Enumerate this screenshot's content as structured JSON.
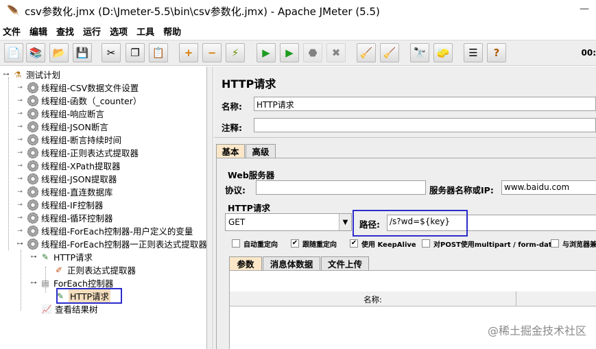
{
  "window": {
    "title": "csv参数化.jmx (D:\\Jmeter-5.5\\bin\\csv参数化.jmx) - Apache JMeter (5.5)",
    "minimize_glyph": "—"
  },
  "menu": [
    "文件",
    "编辑",
    "查找",
    "运行",
    "选项",
    "工具",
    "帮助"
  ],
  "toolbar": {
    "elapsed_time": "00:",
    "buttons": [
      {
        "name": "new-icon",
        "glyph": "📄"
      },
      {
        "name": "templates-icon",
        "glyph": "📚"
      },
      {
        "name": "open-icon",
        "glyph": "📂"
      },
      {
        "name": "save-icon",
        "glyph": "💾"
      },
      {
        "name": "cut-icon",
        "glyph": "✂"
      },
      {
        "name": "copy-icon",
        "glyph": "❐"
      },
      {
        "name": "paste-icon",
        "glyph": "📋"
      },
      {
        "name": "expand-icon",
        "glyph": "+"
      },
      {
        "name": "collapse-icon",
        "glyph": "−"
      },
      {
        "name": "toggle-icon",
        "glyph": "⚡"
      },
      {
        "name": "start-icon",
        "glyph": "▶"
      },
      {
        "name": "start-no-pause-icon",
        "glyph": "▶"
      },
      {
        "name": "stop-icon",
        "glyph": "⬣"
      },
      {
        "name": "shutdown-icon",
        "glyph": "✖"
      },
      {
        "name": "clear-icon",
        "glyph": "🧹"
      },
      {
        "name": "clear-all-icon",
        "glyph": "🧹"
      },
      {
        "name": "search-icon",
        "glyph": "🔭"
      },
      {
        "name": "reset-search-icon",
        "glyph": "🧽"
      },
      {
        "name": "function-helper-icon",
        "glyph": "☰"
      },
      {
        "name": "help-icon",
        "glyph": "?"
      }
    ]
  },
  "tree": {
    "root": "测试计划",
    "items": [
      "线程组-CSV数据文件设置",
      "线程组-函数（_counter）",
      "线程组-响应断言",
      "线程组-JSON断言",
      "线程组-断言持续时间",
      "线程组-正则表达式提取器",
      "线程组-XPath提取器",
      "线程组-JSON提取器",
      "线程组-直连数据库",
      "线程组-IF控制器",
      "线程组-循环控制器",
      "线程组-ForEach控制器-用户定义的变量",
      "线程组-ForEach控制器一正则表达式提取器"
    ],
    "children": {
      "http_request": "HTTP请求",
      "regex_extractor": "正则表达式提取器",
      "foreach_controller": "ForEach控制器",
      "foreach_http_request": "HTTP请求",
      "view_results_tree": "查看结果树"
    }
  },
  "panel": {
    "title": "HTTP请求",
    "name_label": "名称:",
    "name_value": "HTTP请求",
    "comment_label": "注释:",
    "comment_value": "",
    "tabs": [
      "基本",
      "高级"
    ],
    "web_server_title": "Web服务器",
    "protocol_label": "协议:",
    "protocol_value": "",
    "server_label": "服务器名称或IP:",
    "server_value": "www.baidu.com",
    "http_request_title": "HTTP请求",
    "method": "GET",
    "path_label": "路径:",
    "path_value": "/s?wd=${key}",
    "checkboxes": [
      {
        "label": "自动重定向",
        "checked": false
      },
      {
        "label": "跟随重定向",
        "checked": true
      },
      {
        "label": "使用 KeepAlive",
        "checked": true
      },
      {
        "label": "对POST使用multipart / form-data",
        "checked": false
      },
      {
        "label": "与浏览器兼",
        "checked": false
      }
    ],
    "sub_tabs": [
      "参数",
      "消息体数据",
      "文件上传"
    ],
    "table_header": "名称:"
  },
  "watermark": "@稀土掘金技术社区"
}
